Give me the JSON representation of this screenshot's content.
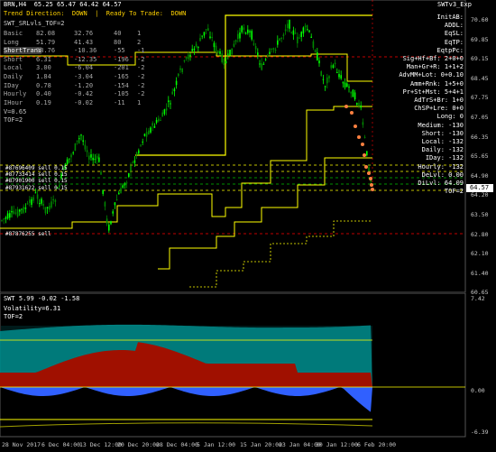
{
  "header": {
    "symbol_line": "BRN,H4  65.25 65.47 64.42 64.57",
    "trend_label": "Trend Direction:  DOWN",
    "ready_label": "Ready To Trade:  DOWN",
    "indicator": "SWT_SRLvls_TOF=2",
    "top_right": "SWTv3_Exp"
  },
  "stats": [
    {
      "k": "Basic",
      "a": "82.08",
      "b": "32.76",
      "c": "40",
      "d": "1"
    },
    {
      "k": "Long",
      "a": "51.79",
      "b": "41.43",
      "c": "80",
      "d": "2"
    },
    {
      "k": "ShortTrans",
      "a": "38.76",
      "b": "-10.36",
      "c": "-55",
      "d": "-1"
    },
    {
      "k": "Short",
      "a": "6.31",
      "b": "-12.35",
      "c": "-196",
      "d": "-2"
    },
    {
      "k": "Local",
      "a": "3.00",
      "b": "-6.04",
      "c": "-201",
      "d": "-2"
    },
    {
      "k": "Daily",
      "a": "1.84",
      "b": "-3.04",
      "c": "-165",
      "d": "-2"
    },
    {
      "k": "IDay",
      "a": "0.78",
      "b": "-1.20",
      "c": "-154",
      "d": "-2"
    },
    {
      "k": "Hourly",
      "a": "0.40",
      "b": "-0.42",
      "c": "-105",
      "d": "-2"
    },
    {
      "k": "IHour",
      "a": "0.19",
      "b": "-0.02",
      "c": "-11",
      "d": "1"
    }
  ],
  "v_line": "V=0.65",
  "tof_line": "TOF=2",
  "right_stats": [
    "InitAB:",
    "ADDL:",
    "EqSL:",
    "EqTP:",
    "EqtpPc:",
    "Sig+Hf+Bf:  2+0+0",
    "Man+Gr+R:  1+1+2",
    "AdvMM+Lot:  0+0.10",
    "Amm+Rnk:  1+5+0",
    "Pr+St+Mst:  5+4+1",
    "AdTrS+Br:  1+0",
    "ChSP+Lre:  0+0",
    "Long:  0",
    "Medium:  -130",
    "Short:  -130",
    "Local:  -132",
    "Daily:  -132",
    "IDay:  -132",
    "Hourly:  -132",
    "DeLvl:  0.00",
    "DiLvl:  64.09",
    "TOF=2"
  ],
  "order_labels": [
    "#87696409 sell 0.15",
    "#87733414 sell 0.15",
    "#87901900 sell 0.15",
    "#87931622 sell 0.15",
    "#87876255 sell"
  ],
  "price_scale": [
    "70.60",
    "69.85",
    "69.15",
    "68.45",
    "67.75",
    "67.05",
    "66.35",
    "65.65",
    "64.90",
    "64.20",
    "63.50",
    "62.80",
    "62.10",
    "61.40",
    "60.65"
  ],
  "current_price": "64.57",
  "sub_header": "SWT 5.99 -0.02 -1.58",
  "volatility": "Volatility=6.31",
  "sub_tof": "TOF=2",
  "sub_scale": [
    "7.42",
    "0.00",
    "-6.39"
  ],
  "x_labels": [
    "28 Nov 2017",
    "6 Dec 04:00",
    "13 Dec 12:00",
    "20 Dec 20:00",
    "28 Dec 04:00",
    "5 Jan 12:00",
    "15 Jan 20:00",
    "23 Jan 04:00",
    "30 Jan 12:00",
    "6 Feb 20:00"
  ],
  "colors": {
    "bull": "#00ff00",
    "bear": "#008800",
    "level": "#ffff00",
    "teal": "#008080",
    "red": "#a01000",
    "blue": "#3060ff"
  }
}
